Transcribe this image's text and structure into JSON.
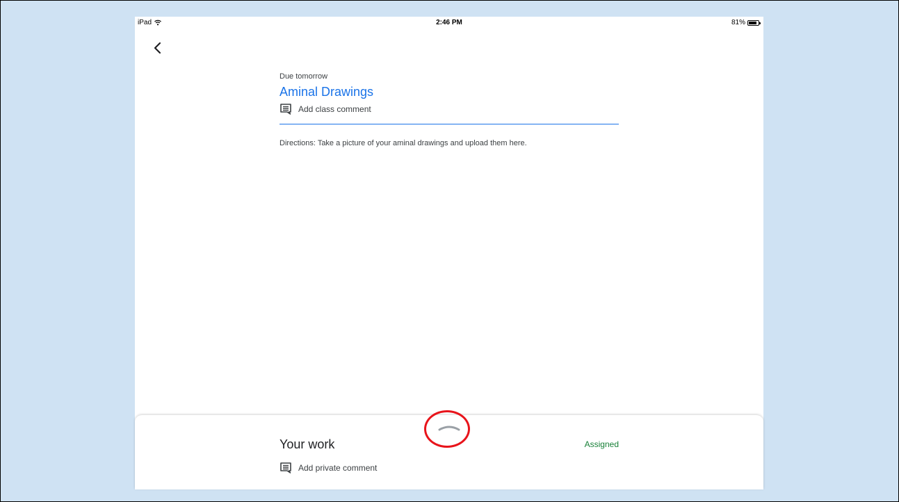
{
  "status_bar": {
    "device": "iPad",
    "time": "2:46 PM",
    "battery_percent": "81%",
    "battery_level": 0.81
  },
  "icons": {
    "wifi": "wifi-icon",
    "battery": "battery-icon",
    "back": "chevron-left-icon",
    "comment": "comment-icon",
    "handle": "chevron-up-icon"
  },
  "assignment": {
    "due": "Due tomorrow",
    "title": "Aminal Drawings",
    "class_comment_label": "Add class comment",
    "directions": "Directions:  Take a picture of your aminal drawings and upload them here."
  },
  "your_work": {
    "title": "Your work",
    "status": "Assigned",
    "private_comment_label": "Add private comment"
  },
  "colors": {
    "slide_background": "#cfe2f3",
    "accent_blue": "#1a73e8",
    "status_green": "#188038",
    "highlight_red": "#e8141b"
  }
}
